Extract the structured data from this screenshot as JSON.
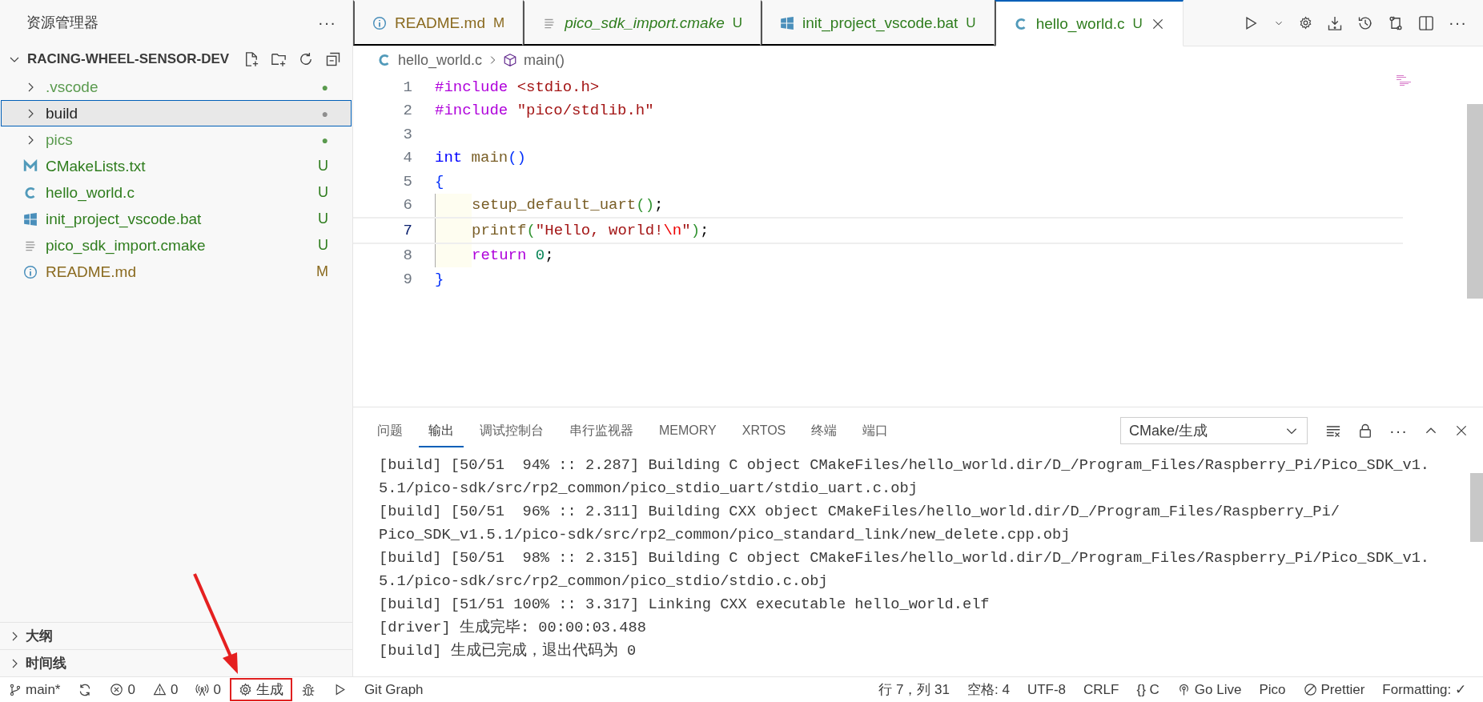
{
  "sidebar": {
    "title": "资源管理器",
    "more": "···",
    "folder": {
      "name": "RACING-WHEEL-SENSOR-DEV",
      "expanded": true,
      "items": [
        {
          "name": ".vscode",
          "kind": "folder",
          "expanded": false,
          "selected": false,
          "color": "#5a9a4e",
          "badge": "●"
        },
        {
          "name": "build",
          "kind": "folder",
          "expanded": false,
          "selected": true,
          "color": "#8e8e8e",
          "badge": "●"
        },
        {
          "name": "pics",
          "kind": "folder",
          "expanded": false,
          "selected": false,
          "color": "#5a9a4e",
          "badge": "●"
        },
        {
          "name": "CMakeLists.txt",
          "kind": "cmake",
          "selected": false,
          "color": "#2f7d1e",
          "badge": "U"
        },
        {
          "name": "hello_world.c",
          "kind": "c",
          "selected": false,
          "color": "#2f7d1e",
          "badge": "U"
        },
        {
          "name": "init_project_vscode.bat",
          "kind": "windows",
          "selected": false,
          "color": "#2f7d1e",
          "badge": "U"
        },
        {
          "name": "pico_sdk_import.cmake",
          "kind": "text",
          "selected": false,
          "color": "#2f7d1e",
          "badge": "U"
        },
        {
          "name": "README.md",
          "kind": "info",
          "selected": false,
          "color": "#8a6a1f",
          "badge": "M"
        }
      ]
    },
    "sections": [
      {
        "name": "大纲",
        "expanded": false
      },
      {
        "name": "时间线",
        "expanded": false
      }
    ]
  },
  "tabs": [
    {
      "name": "README.md",
      "kind": "info",
      "badge": "M",
      "color": "#8a6a1f",
      "italic": false,
      "selected": false
    },
    {
      "name": "pico_sdk_import.cmake",
      "kind": "text",
      "badge": "U",
      "color": "#2f7d1e",
      "italic": true,
      "selected": false
    },
    {
      "name": "init_project_vscode.bat",
      "kind": "windows",
      "badge": "U",
      "color": "#2f7d1e",
      "italic": false,
      "selected": false
    },
    {
      "name": "hello_world.c",
      "kind": "c",
      "badge": "U",
      "color": "#2f7d1e",
      "italic": false,
      "selected": true
    }
  ],
  "breadcrumb": [
    {
      "name": "hello_world.c",
      "kind": "c"
    },
    {
      "name": "main()",
      "kind": "cube"
    }
  ],
  "code": [
    {
      "number": "1",
      "current": false,
      "guide": false,
      "tokens": [
        {
          "text": "#include ",
          "kind": "directive"
        },
        {
          "text": "<stdio.h>",
          "kind": "string"
        }
      ]
    },
    {
      "number": "2",
      "current": false,
      "guide": false,
      "tokens": [
        {
          "text": "#include ",
          "kind": "directive"
        },
        {
          "text": "\"pico/stdlib.h\"",
          "kind": "string"
        }
      ]
    },
    {
      "number": "3",
      "current": false,
      "guide": false
    },
    {
      "number": "4",
      "current": false,
      "guide": false,
      "tokens": [
        {
          "text": "int ",
          "kind": "type"
        },
        {
          "text": "main",
          "kind": "func"
        },
        {
          "text": "()",
          "kind": "bracket1"
        }
      ]
    },
    {
      "number": "5",
      "current": false,
      "guide": false,
      "tokens": [
        {
          "text": "{",
          "kind": "bracket1"
        }
      ]
    },
    {
      "number": "6",
      "current": false,
      "guide": true,
      "tokens": [
        {
          "text": "setup_default_uart",
          "kind": "func"
        },
        {
          "text": "()",
          "kind": "bracket2"
        },
        {
          "text": ";",
          "kind": "plain"
        }
      ]
    },
    {
      "number": "7",
      "current": true,
      "guide": true,
      "tokens": [
        {
          "text": "printf",
          "kind": "func"
        },
        {
          "text": "(",
          "kind": "bracket2"
        },
        {
          "text": "\"Hello, world!",
          "kind": "string"
        },
        {
          "text": "\\n",
          "kind": "escape"
        },
        {
          "text": "\"",
          "kind": "string"
        },
        {
          "text": ")",
          "kind": "bracket2"
        },
        {
          "text": ";",
          "kind": "plain"
        }
      ]
    },
    {
      "number": "8",
      "current": false,
      "guide": true,
      "tokens": [
        {
          "text": "return ",
          "kind": "control"
        },
        {
          "text": "0",
          "kind": "number"
        },
        {
          "text": ";",
          "kind": "plain"
        }
      ]
    },
    {
      "number": "9",
      "current": false,
      "guide": false,
      "tokens": [
        {
          "text": "}",
          "kind": "bracket1"
        }
      ]
    }
  ],
  "panel": {
    "tabs": [
      {
        "label": "问题",
        "selected": false
      },
      {
        "label": "输出",
        "selected": true
      },
      {
        "label": "调试控制台",
        "selected": false
      },
      {
        "label": "串行监视器",
        "selected": false
      },
      {
        "label": "MEMORY",
        "selected": false
      },
      {
        "label": "XRTOS",
        "selected": false
      },
      {
        "label": "终端",
        "selected": false
      },
      {
        "label": "端口",
        "selected": false
      }
    ],
    "channel": "CMake/生成",
    "output": [
      "[build] [50/51  94% :: 2.287] Building C object CMakeFiles/hello_world.dir/D_/Program_Files/Raspberry_Pi/Pico_SDK_v1.",
      "5.1/pico-sdk/src/rp2_common/pico_stdio_uart/stdio_uart.c.obj",
      "[build] [50/51  96% :: 2.311] Building CXX object CMakeFiles/hello_world.dir/D_/Program_Files/Raspberry_Pi/",
      "Pico_SDK_v1.5.1/pico-sdk/src/rp2_common/pico_standard_link/new_delete.cpp.obj",
      "[build] [50/51  98% :: 2.315] Building C object CMakeFiles/hello_world.dir/D_/Program_Files/Raspberry_Pi/Pico_SDK_v1.",
      "5.1/pico-sdk/src/rp2_common/pico_stdio/stdio.c.obj",
      "[build] [51/51 100% :: 3.317] Linking CXX executable hello_world.elf",
      "[driver] 生成完毕: 00:00:03.488",
      "[build] 生成已完成，退出代码为 0"
    ]
  },
  "status_bar": {
    "left": [
      {
        "kind": "branch",
        "text": "main*",
        "highlighted": false
      },
      {
        "kind": "sync",
        "highlighted": false
      },
      {
        "kind": "error",
        "text": "0",
        "highlighted": false
      },
      {
        "kind": "warning",
        "text": "0",
        "highlighted": false
      },
      {
        "kind": "antenna",
        "text": "0",
        "highlighted": false
      },
      {
        "kind": "gear",
        "text": "生成",
        "highlighted": true
      },
      {
        "kind": "bug",
        "highlighted": false
      },
      {
        "kind": "play",
        "highlighted": false
      },
      {
        "kind": "text",
        "text": "Git Graph",
        "highlighted": false
      }
    ],
    "right": [
      {
        "kind": "text",
        "text": "行 7，列 31"
      },
      {
        "kind": "text",
        "text": "空格: 4"
      },
      {
        "kind": "text",
        "text": "UTF-8"
      },
      {
        "kind": "text",
        "text": "CRLF"
      },
      {
        "kind": "text",
        "text": "{} C"
      },
      {
        "kind": "broadcast",
        "text": "Go Live"
      },
      {
        "kind": "text",
        "text": "Pico"
      },
      {
        "kind": "prohibit",
        "text": "Prettier"
      },
      {
        "kind": "text",
        "text": "Formatting: ✓"
      }
    ]
  }
}
